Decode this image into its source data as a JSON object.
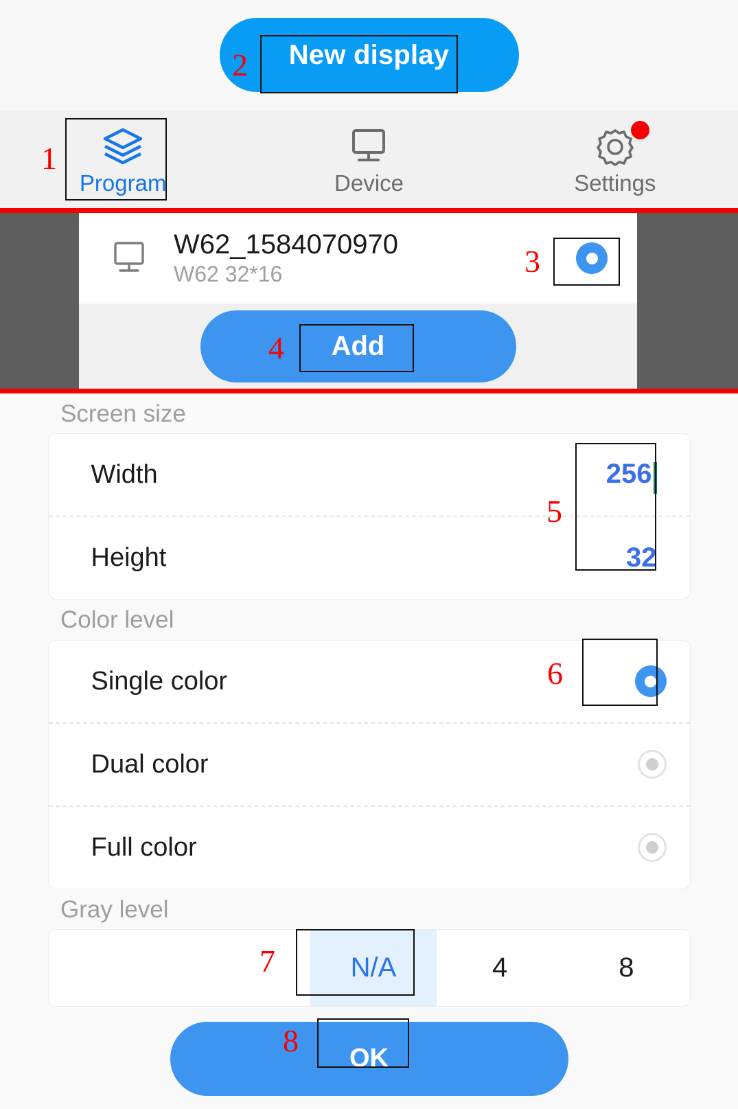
{
  "topbar": {
    "new_display_label": "New display",
    "annotation": "2"
  },
  "tabs": [
    {
      "label": "Program",
      "icon": "layers-icon",
      "active": true,
      "annotation": "1"
    },
    {
      "label": "Device",
      "icon": "monitor-icon",
      "active": false
    },
    {
      "label": "Settings",
      "icon": "gear-icon",
      "active": false,
      "badge": true
    }
  ],
  "device_list": {
    "item": {
      "icon": "monitor-icon",
      "title": "W62_1584070970",
      "subtitle": "W62  32*16",
      "selected": true,
      "annotation": "3"
    },
    "add_label": "Add",
    "add_annotation": "4"
  },
  "screen_size": {
    "section_label": "Screen size",
    "annotation": "5",
    "rows": [
      {
        "label": "Width",
        "value": "256",
        "has_caret": true
      },
      {
        "label": "Height",
        "value": "32",
        "has_caret": false
      }
    ]
  },
  "color_level": {
    "section_label": "Color level",
    "annotation": "6",
    "options": [
      {
        "label": "Single color",
        "selected": true
      },
      {
        "label": "Dual color",
        "selected": false
      },
      {
        "label": "Full color",
        "selected": false
      }
    ]
  },
  "gray_level": {
    "section_label": "Gray level",
    "annotation": "7",
    "options": [
      {
        "label": "N/A",
        "selected": true
      },
      {
        "label": "4",
        "selected": false
      },
      {
        "label": "8",
        "selected": false
      }
    ]
  },
  "footer": {
    "ok_label": "OK",
    "annotation": "8"
  },
  "colors": {
    "primary_blue": "#089cf4",
    "button_blue": "#3d95f0",
    "accent_text_blue": "#3a6fe8",
    "tab_active_blue": "#1877e6",
    "annotation_red": "#fb0000",
    "divider_red": "#f60000",
    "panel_dark": "#5e5e5e",
    "caret_teal": "#118270"
  }
}
